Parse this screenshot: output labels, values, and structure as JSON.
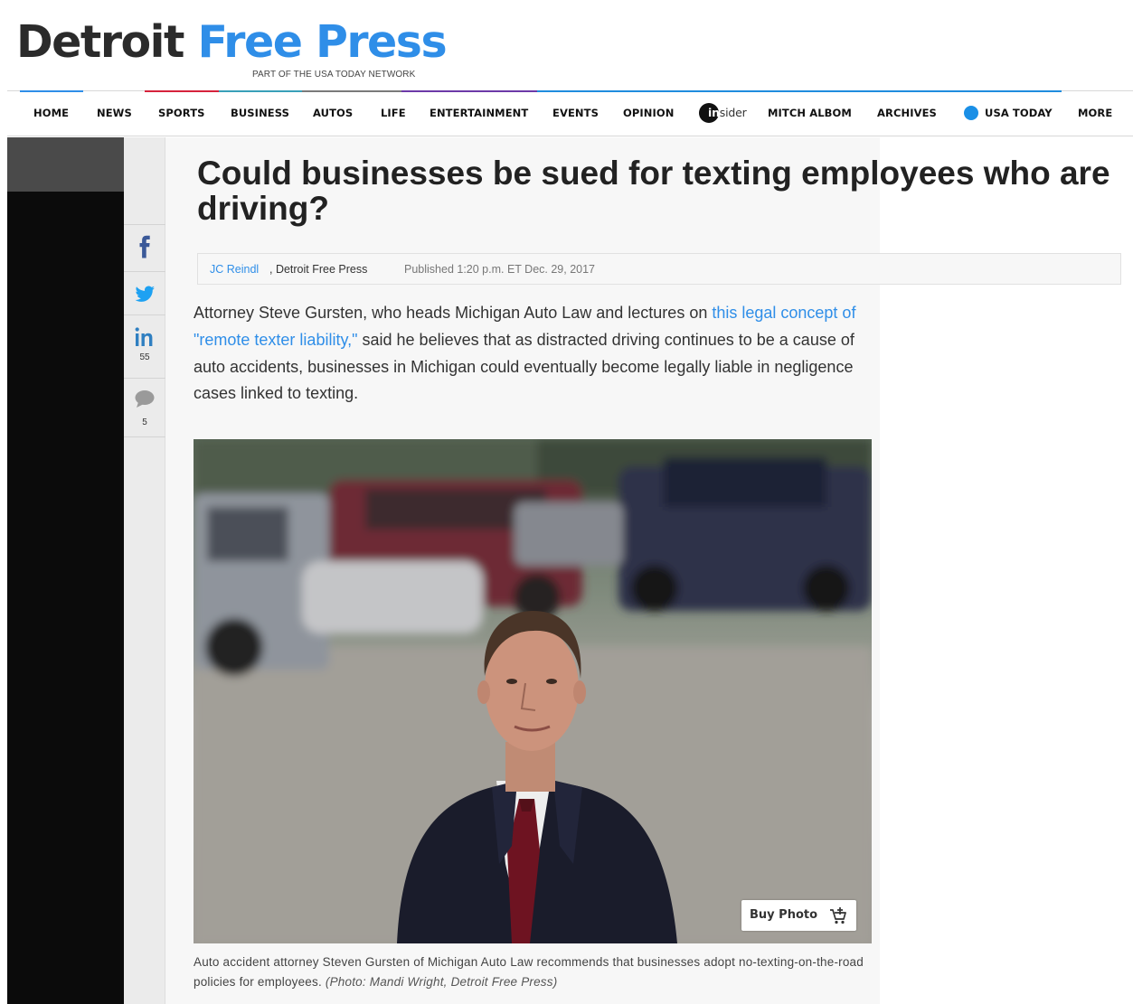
{
  "masthead": {
    "logo_left": "Detroit",
    "logo_right": "Free Press",
    "tagline": "PART OF THE USA TODAY NETWORK"
  },
  "nav": {
    "items": [
      "HOME",
      "NEWS",
      "SPORTS",
      "BUSINESS",
      "AUTOS",
      "LIFE",
      "ENTERTAINMENT",
      "EVENTS",
      "OPINION",
      "MITCH ALBOM",
      "ARCHIVES",
      "USA TODAY",
      "MORE"
    ],
    "insider_prefix": "in",
    "insider_suffix": "sider"
  },
  "share": {
    "linkedin_count": "55",
    "comments_count": "5"
  },
  "article": {
    "headline": "Could businesses be sued for texting employees who are driving?",
    "byline": {
      "author": "JC Reindl",
      "outlet": ", Detroit Free Press",
      "published": "Published 1:20 p.m. ET Dec. 29, 2017"
    },
    "paragraph": {
      "before_link": "Attorney Steve Gursten, who heads Michigan Auto Law and lectures on ",
      "link_text": "this legal concept of \"remote texter liability,\"",
      "after_link": " said he believes that as distracted driving continues to be a cause of auto accidents, businesses in Michigan could eventually become legally liable in negligence cases linked to texting."
    },
    "photo": {
      "buy_label": "Buy Photo",
      "caption": "Auto accident attorney Steven Gursten of Michigan Auto Law recommends that businesses adopt no-texting-on-the-road policies for employees. ",
      "credit": "(Photo: Mandi Wright, Detroit Free Press)"
    }
  },
  "colors": {
    "brand_blue": "#2f8ee8",
    "logo_dark": "#2b2b2b",
    "rail_dark": "#0b0b0b"
  },
  "icons": [
    "facebook-icon",
    "twitter-icon",
    "linkedin-icon",
    "comment-icon",
    "cart-icon"
  ]
}
